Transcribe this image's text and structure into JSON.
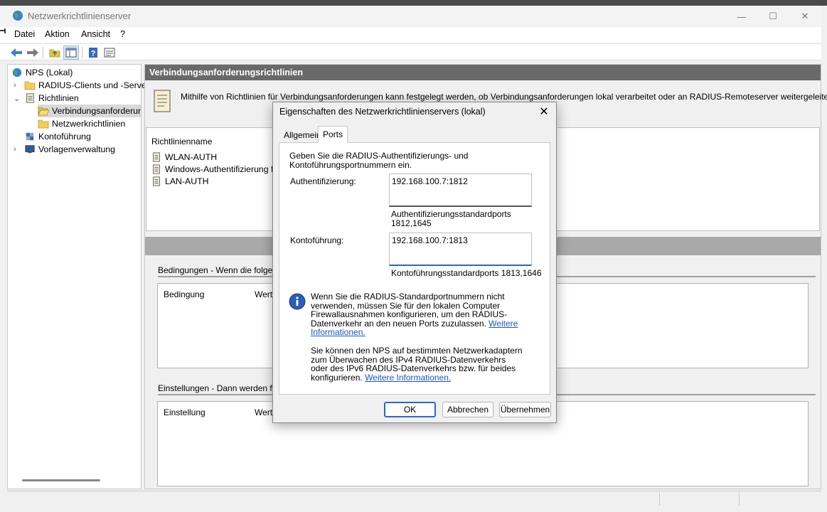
{
  "window": {
    "title": "Netzwerkrichtlinienserver",
    "minimize_glyph": "—",
    "maximize_glyph": "☐",
    "close_glyph": "✕"
  },
  "menu": {
    "items": [
      "Datei",
      "Aktion",
      "Ansicht",
      "?"
    ]
  },
  "toolbar": {
    "icons": [
      "back-arrow-icon",
      "forward-arrow-icon",
      "up-folder-icon",
      "show-hide-tree-icon",
      "help-icon",
      "properties-icon"
    ]
  },
  "tree": {
    "items": [
      {
        "label": "NPS (Lokal)",
        "icon": "globe-icon"
      },
      {
        "label": "RADIUS-Clients und -Server",
        "icon": "folder-icon"
      },
      {
        "label": "Richtlinien",
        "icon": "document-icon"
      },
      {
        "label": "Verbindungsanforderungsrichtlinien",
        "icon": "open-folder-icon"
      },
      {
        "label": "Netzwerkrichtlinien",
        "icon": "folder-icon"
      },
      {
        "label": "Kontoführung",
        "icon": "accounting-icon"
      },
      {
        "label": "Vorlagenverwaltung",
        "icon": "monitor-icon"
      }
    ]
  },
  "main": {
    "header": "Verbindungsanforderungsrichtlinien",
    "intro": "Mithilfe von Richtlinien für Verbindungsanforderungen kann festgelegt werden, ob Verbindungsanforderungen lokal verarbeitet oder an RADIUS-Remoteserver weitergeleitet werden.",
    "list_header": "Richtlinienname",
    "policies": [
      "WLAN-AUTH",
      "Windows-Authentifizierung für alle Benutzer",
      "LAN-AUTH"
    ],
    "conditions_label": "Bedingungen - Wenn die folgenden Bedingungen erfüllt sind:",
    "conditions_cols": [
      "Bedingung",
      "Wert"
    ],
    "settings_label": "Einstellungen - Dann werden folgende Einstellungen angewendet:",
    "settings_cols": [
      "Einstellung",
      "Wert"
    ]
  },
  "dialog": {
    "title": "Eigenschaften des Netzwerkrichtlinienservers (lokal)",
    "tabs": [
      "Allgemein",
      "Ports"
    ],
    "active_tab": "Ports",
    "description": "Geben Sie die RADIUS-Authentifizierungs- und Kontoführungsportnummern ein.",
    "auth_label": "Authentifizierung:",
    "auth_value": "192.168.100.7:1812",
    "auth_hint_line1": "Authentifizierungsstandardports",
    "auth_hint_line2": "1812,1645",
    "acct_label": "Kontoführung:",
    "acct_value": "192.168.100.7:1813",
    "acct_hint": "Kontoführungsstandardports 1813,1646",
    "info1_text": "Wenn Sie die RADIUS-Standardportnummern nicht verwenden, müssen Sie für den lokalen Computer Firewallausnahmen konfigurieren, um den RADIUS-Datenverkehr an den neuen Ports zuzulassen.",
    "info1_link": "Weitere Informationen.",
    "info2_text": "Sie können den NPS auf bestimmten Netzwerkadaptern zum Überwachen des IPv4 RADIUS-Datenverkehrs oder des IPv6 RADIUS-Datenverkehrs bzw. für beides konfigurieren.",
    "info2_link": "Weitere Informationen.",
    "ok": "OK",
    "cancel": "Abbrechen",
    "apply": "Übernehmen",
    "close_glyph": "✕"
  }
}
